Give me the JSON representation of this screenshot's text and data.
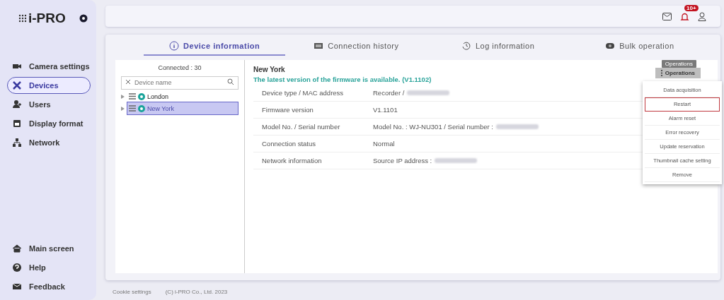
{
  "sidebar": {
    "logo": "i-PRO",
    "items": [
      {
        "label": "Camera settings",
        "selected": false
      },
      {
        "label": "Devices",
        "selected": true
      },
      {
        "label": "Users",
        "selected": false
      },
      {
        "label": "Display format",
        "selected": false
      },
      {
        "label": "Network",
        "selected": false
      }
    ],
    "bottom_items": [
      {
        "label": "Main screen"
      },
      {
        "label": "Help"
      },
      {
        "label": "Feedback"
      }
    ]
  },
  "top_bar": {
    "notification_badge": "10+"
  },
  "tabs": [
    {
      "label": "Device information",
      "selected": true
    },
    {
      "label": "Connection history",
      "selected": false
    },
    {
      "label": "Log information",
      "selected": false
    },
    {
      "label": "Bulk operation",
      "selected": false
    }
  ],
  "device_list": {
    "header": "Connected : 30",
    "search": {
      "placeholder": "Device name"
    },
    "items": [
      {
        "label": "London",
        "selected": false
      },
      {
        "label": "New York",
        "selected": true
      }
    ]
  },
  "details": {
    "title": "New York",
    "notice": "The latest version of the firmware is available. (V1.1102)",
    "rows": [
      {
        "label": "Device type / MAC address",
        "value": "Recorder /",
        "redacted": true
      },
      {
        "label": "Firmware version",
        "value": "V1.1101",
        "redacted": false
      },
      {
        "label": "Model No. / Serial number",
        "value": "Model No. : WJ-NU301 / Serial number :",
        "redacted": true
      },
      {
        "label": "Connection status",
        "value": "Normal",
        "redacted": false
      },
      {
        "label": "Network information",
        "value": "Source IP address :",
        "redacted": true
      }
    ]
  },
  "operations": {
    "tooltip": "Operations",
    "button": "Operations",
    "menu": [
      {
        "label": "Data acquisition",
        "selected": false
      },
      {
        "label": "Restart",
        "selected": true
      },
      {
        "label": "Alarm reset",
        "selected": false
      },
      {
        "label": "Error recovery",
        "selected": false
      },
      {
        "label": "Update reservation",
        "selected": false
      },
      {
        "label": "Thumbnail cache setting",
        "selected": false
      },
      {
        "label": "Remove",
        "selected": false
      }
    ]
  },
  "footer": {
    "links": [
      "Cookie settings",
      "(C) i-PRO Co., Ltd. 2023"
    ]
  }
}
